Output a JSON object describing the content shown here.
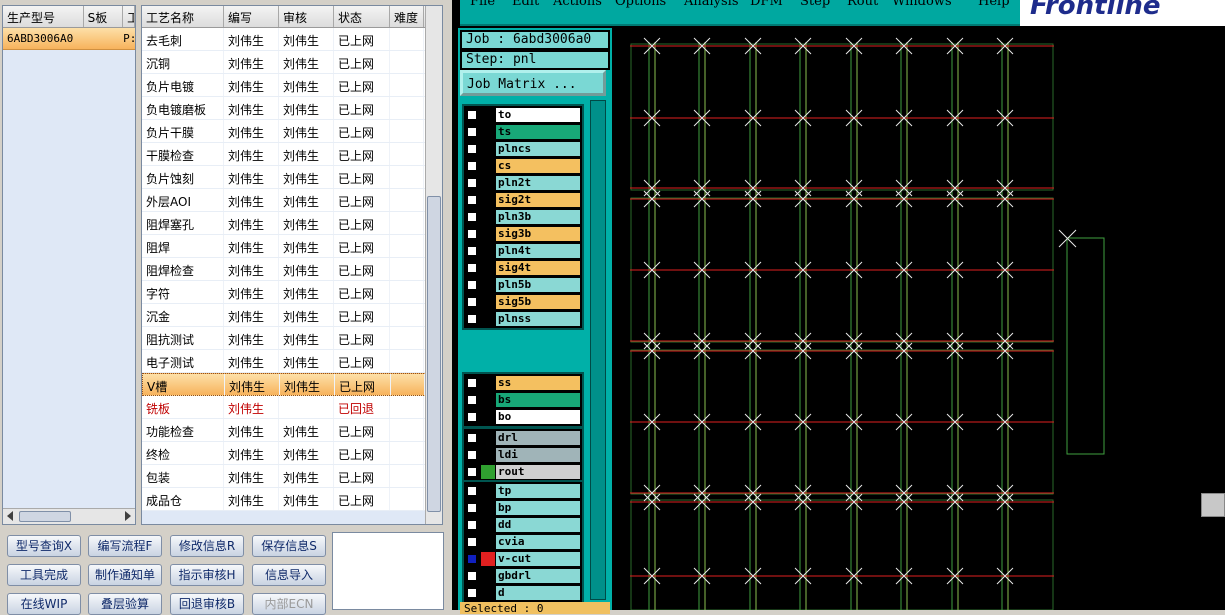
{
  "model_panel": {
    "columns": [
      "生产型号",
      "S板",
      "工"
    ],
    "rows": [
      [
        "6ABD3006A0",
        "P:",
        ""
      ]
    ]
  },
  "process_panel": {
    "columns": [
      "工艺名称",
      "编写",
      "审核",
      "状态",
      "难度"
    ],
    "rows": [
      [
        "去毛刺",
        "刘伟生",
        "刘伟生",
        "已上网",
        ""
      ],
      [
        "沉铜",
        "刘伟生",
        "刘伟生",
        "已上网",
        ""
      ],
      [
        "负片电镀",
        "刘伟生",
        "刘伟生",
        "已上网",
        ""
      ],
      [
        "负电镀磨板",
        "刘伟生",
        "刘伟生",
        "已上网",
        ""
      ],
      [
        "负片干膜",
        "刘伟生",
        "刘伟生",
        "已上网",
        ""
      ],
      [
        "干膜检查",
        "刘伟生",
        "刘伟生",
        "已上网",
        ""
      ],
      [
        "负片蚀刻",
        "刘伟生",
        "刘伟生",
        "已上网",
        ""
      ],
      [
        "外层AOI",
        "刘伟生",
        "刘伟生",
        "已上网",
        ""
      ],
      [
        "阻焊塞孔",
        "刘伟生",
        "刘伟生",
        "已上网",
        ""
      ],
      [
        "阻焊",
        "刘伟生",
        "刘伟生",
        "已上网",
        ""
      ],
      [
        "阻焊检查",
        "刘伟生",
        "刘伟生",
        "已上网",
        ""
      ],
      [
        "字符",
        "刘伟生",
        "刘伟生",
        "已上网",
        ""
      ],
      [
        "沉金",
        "刘伟生",
        "刘伟生",
        "已上网",
        ""
      ],
      [
        "阻抗测试",
        "刘伟生",
        "刘伟生",
        "已上网",
        ""
      ],
      [
        "电子测试",
        "刘伟生",
        "刘伟生",
        "已上网",
        ""
      ],
      [
        "V槽",
        "刘伟生",
        "刘伟生",
        "已上网",
        ""
      ],
      [
        "铣板",
        "刘伟生",
        "",
        "已回退",
        ""
      ],
      [
        "功能检查",
        "刘伟生",
        "刘伟生",
        "已上网",
        ""
      ],
      [
        "终检",
        "刘伟生",
        "刘伟生",
        "已上网",
        ""
      ],
      [
        "包装",
        "刘伟生",
        "刘伟生",
        "已上网",
        ""
      ],
      [
        "成品仓",
        "刘伟生",
        "刘伟生",
        "已上网",
        ""
      ]
    ],
    "selected_row": 15,
    "rejected_row": 16
  },
  "buttons": {
    "model_query": "型号查询X",
    "edit_flow": "编写流程F",
    "modify_info": "修改信息R",
    "save_info": "保存信息S",
    "tool_done": "工具完成",
    "make_notice": "制作通知单",
    "review": "指示审核H",
    "import_info": "信息导入",
    "online_wip": "在线WIP",
    "stack_check": "叠层验算",
    "return_review": "回退审核B",
    "internal_ecn": "内部ECN"
  },
  "cam": {
    "menu": [
      "File",
      "Edit",
      "Actions",
      "Options",
      "Analysis",
      "DFM",
      "Step",
      "Rout",
      "Windows",
      "Help"
    ],
    "logo": "Frontline",
    "job": "Job : 6abd3006a0",
    "step": "Step: pnl",
    "job_matrix": "Job Matrix ...",
    "selected": "Selected : 0",
    "layer_groups": [
      [
        {
          "name": "to",
          "bg": "#ffffff"
        },
        {
          "name": "ts",
          "bg": "#18a878"
        },
        {
          "name": "plncs",
          "bg": "#8ad8d4"
        },
        {
          "name": "cs",
          "bg": "#f4c060"
        },
        {
          "name": "pln2t",
          "bg": "#8ad8d4"
        },
        {
          "name": "sig2t",
          "bg": "#f4c060"
        },
        {
          "name": "pln3b",
          "bg": "#8ad8d4"
        },
        {
          "name": "sig3b",
          "bg": "#f4c060"
        },
        {
          "name": "pln4t",
          "bg": "#8ad8d4"
        },
        {
          "name": "sig4t",
          "bg": "#f4c060"
        },
        {
          "name": "pln5b",
          "bg": "#8ad8d4"
        },
        {
          "name": "sig5b",
          "bg": "#f4c060"
        },
        {
          "name": "plnss",
          "bg": "#8ad8d4"
        }
      ],
      [
        {
          "name": "ss",
          "bg": "#f4c060"
        },
        {
          "name": "bs",
          "bg": "#18a878"
        },
        {
          "name": "bo",
          "bg": "#ffffff"
        }
      ],
      [
        {
          "name": "drl",
          "bg": "#a0b4b8"
        },
        {
          "name": "ldi",
          "bg": "#a0b4b8"
        },
        {
          "name": "rout",
          "bg": "#d0d0d0",
          "mark": "#30a030"
        }
      ],
      [
        {
          "name": "tp",
          "bg": "#8ad8d4"
        },
        {
          "name": "bp",
          "bg": "#8ad8d4"
        },
        {
          "name": "dd",
          "bg": "#8ad8d4"
        },
        {
          "name": "cvia",
          "bg": "#8ad8d4"
        },
        {
          "name": "v-cut",
          "bg": "#8ad8d4",
          "mark": "#e02020",
          "active": true
        },
        {
          "name": "gbdrl",
          "bg": "#8ad8d4"
        },
        {
          "name": "d",
          "bg": "#8ad8d4"
        }
      ]
    ]
  }
}
